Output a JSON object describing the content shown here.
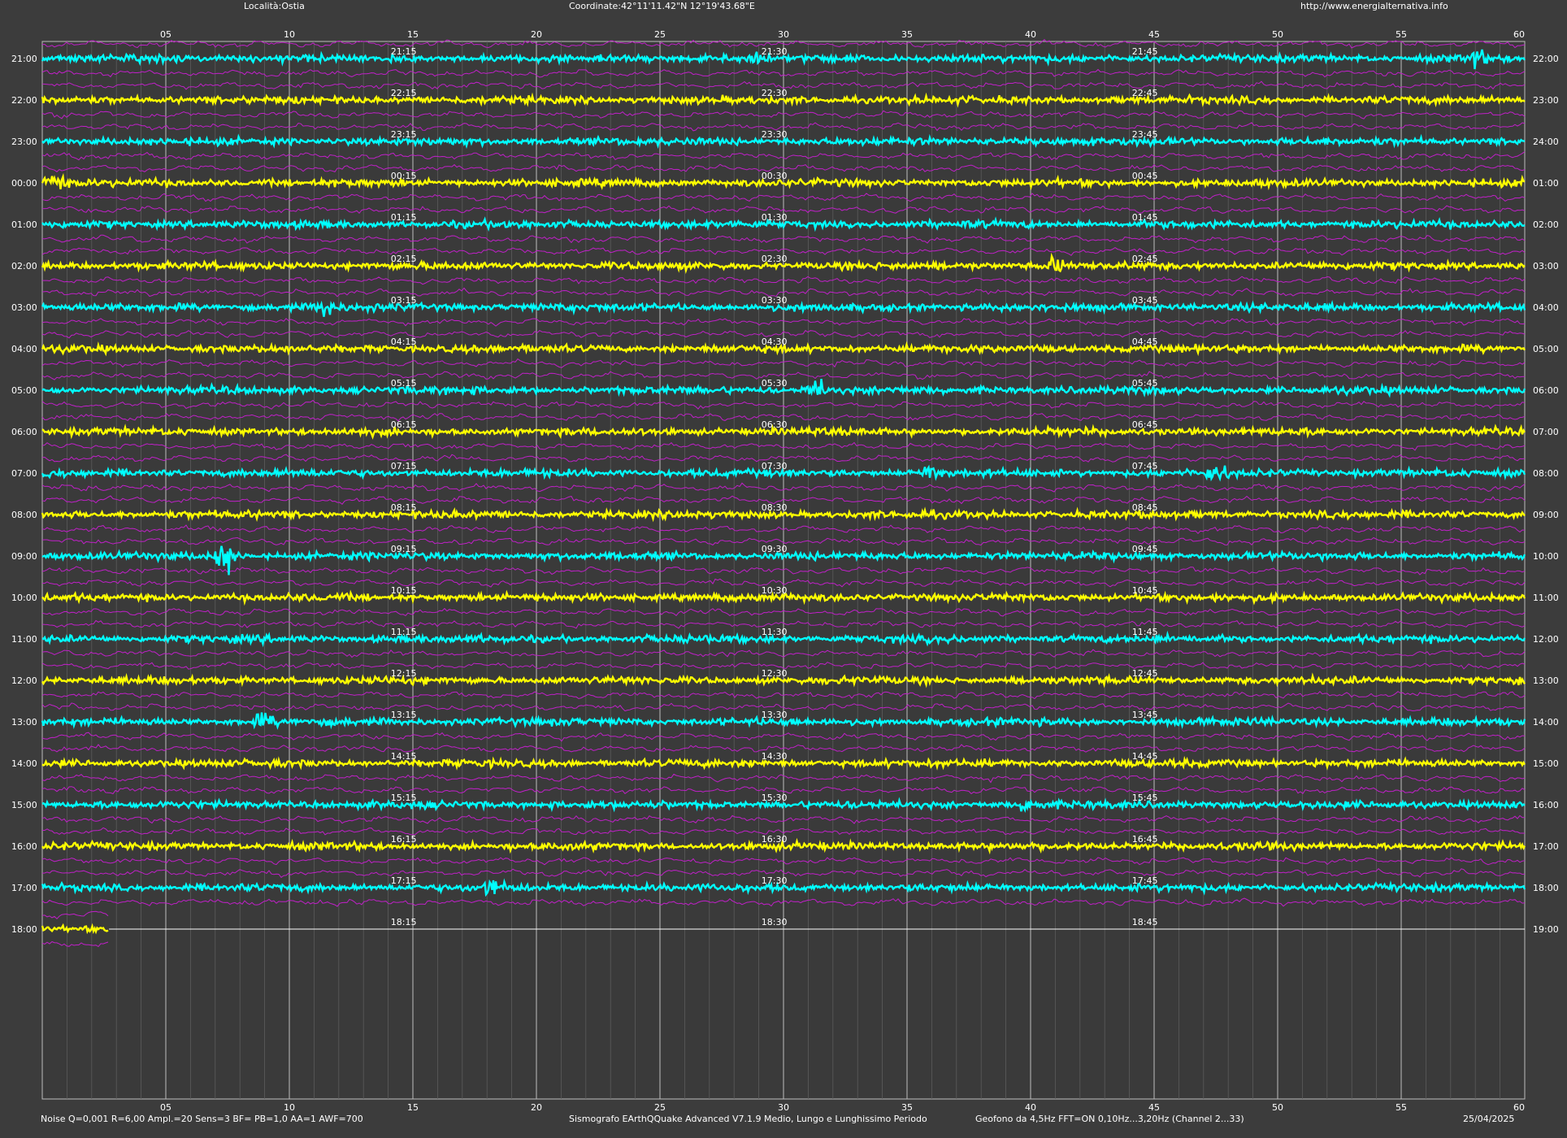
{
  "header": {
    "location": "Località:Ostia",
    "coordinates": "Coordinate:42°11'11.42\"N  12°19'43.68\"E",
    "website": "http://www.energialternativa.info"
  },
  "footer": {
    "settings": "Noise Q=0,001 R=6,00 Ampl.=20 Sens=3 BF= PB=1,0 AA=1 AWF=700",
    "software": "Sismografo  EArthQQuake Advanced V7.1.9  Medio, Lungo e Lunghissimo Periodo",
    "sensor": "Geofono da 4,5Hz FFT=ON 0,10Hz...3,20Hz     (Channel 2...33)",
    "date": "25/04/2025"
  },
  "colors": {
    "background": "#3c3c3c",
    "plot_background": "#3a3a3a",
    "trace_cyan": "#00ffff",
    "trace_yellow": "#ffff00",
    "trace_magenta": "#c020c8",
    "grid_major": "#bdbdbd",
    "grid_minor": "#5c5c5c",
    "text": "#ffffff"
  },
  "chart_data": {
    "type": "line",
    "xlabel": "",
    "ylabel": "",
    "xlim": [
      0,
      60
    ],
    "x_ticks": [
      "05",
      "10",
      "15",
      "20",
      "25",
      "30",
      "35",
      "40",
      "45",
      "50",
      "55",
      "60"
    ],
    "minor_tick_interval_minutes": 1,
    "rows_left_labels": [
      "21:00",
      "22:00",
      "23:00",
      "00:00",
      "01:00",
      "02:00",
      "03:00",
      "04:00",
      "05:00",
      "06:00",
      "07:00",
      "08:00",
      "09:00",
      "10:00",
      "11:00",
      "12:00",
      "13:00",
      "14:00",
      "15:00",
      "16:00",
      "17:00",
      "18:00"
    ],
    "rows_right_labels": [
      "22:00",
      "23:00",
      "24:00",
      "01:00",
      "02:00",
      "03:00",
      "04:00",
      "05:00",
      "06:00",
      "07:00",
      "08:00",
      "09:00",
      "10:00",
      "11:00",
      "12:00",
      "13:00",
      "14:00",
      "15:00",
      "16:00",
      "17:00",
      "18:00",
      "19:00"
    ],
    "quarter_labels": [
      [
        "21:15",
        "21:30",
        "21:45"
      ],
      [
        "22:15",
        "22:30",
        "22:45"
      ],
      [
        "23:15",
        "23:30",
        "23:45"
      ],
      [
        "00:15",
        "00:30",
        "00:45"
      ],
      [
        "01:15",
        "01:30",
        "01:45"
      ],
      [
        "02:15",
        "02:30",
        "02:45"
      ],
      [
        "03:15",
        "03:30",
        "03:45"
      ],
      [
        "04:15",
        "04:30",
        "04:45"
      ],
      [
        "05:15",
        "05:30",
        "05:45"
      ],
      [
        "06:15",
        "06:30",
        "06:45"
      ],
      [
        "07:15",
        "07:30",
        "07:45"
      ],
      [
        "08:15",
        "08:30",
        "08:45"
      ],
      [
        "09:15",
        "09:30",
        "09:45"
      ],
      [
        "10:15",
        "10:30",
        "10:45"
      ],
      [
        "11:15",
        "11:30",
        "11:45"
      ],
      [
        "12:15",
        "12:30",
        "12:45"
      ],
      [
        "13:15",
        "13:30",
        "13:45"
      ],
      [
        "14:15",
        "14:30",
        "14:45"
      ],
      [
        "15:15",
        "15:30",
        "15:45"
      ],
      [
        "16:15",
        "16:30",
        "16:45"
      ],
      [
        "17:15",
        "17:30",
        "17:45"
      ],
      [
        "18:15",
        "18:30",
        "18:45"
      ]
    ],
    "quarter_minutes": [
      14.5,
      29.5,
      44.5
    ],
    "row_colors": [
      "cyan",
      "yellow",
      "cyan",
      "yellow",
      "cyan",
      "yellow",
      "cyan",
      "yellow",
      "cyan",
      "yellow",
      "cyan",
      "yellow",
      "cyan",
      "yellow",
      "cyan",
      "yellow",
      "cyan",
      "yellow",
      "cyan",
      "yellow",
      "cyan",
      "yellow"
    ],
    "last_row_recorded_until_minute": 2.7,
    "events": [
      {
        "row": 12,
        "minute": 7.4,
        "amplitude": 3.4
      },
      {
        "row": 8,
        "minute": 31.3,
        "amplitude": 2.0
      },
      {
        "row": 6,
        "minute": 11.5,
        "amplitude": 1.6
      },
      {
        "row": 3,
        "minute": 0.5,
        "amplitude": 1.6
      },
      {
        "row": 10,
        "minute": 36.0,
        "amplitude": 1.4
      },
      {
        "row": 10,
        "minute": 47.5,
        "amplitude": 1.4
      },
      {
        "row": 20,
        "minute": 18.2,
        "amplitude": 1.5
      },
      {
        "row": 18,
        "minute": 40.0,
        "amplitude": 1.6
      },
      {
        "row": 5,
        "minute": 41.0,
        "amplitude": 1.4
      },
      {
        "row": 0,
        "minute": 29.0,
        "amplitude": 1.3
      },
      {
        "row": 0,
        "minute": 58.0,
        "amplitude": 1.3
      },
      {
        "row": 16,
        "minute": 9.0,
        "amplitude": 1.3
      }
    ]
  }
}
